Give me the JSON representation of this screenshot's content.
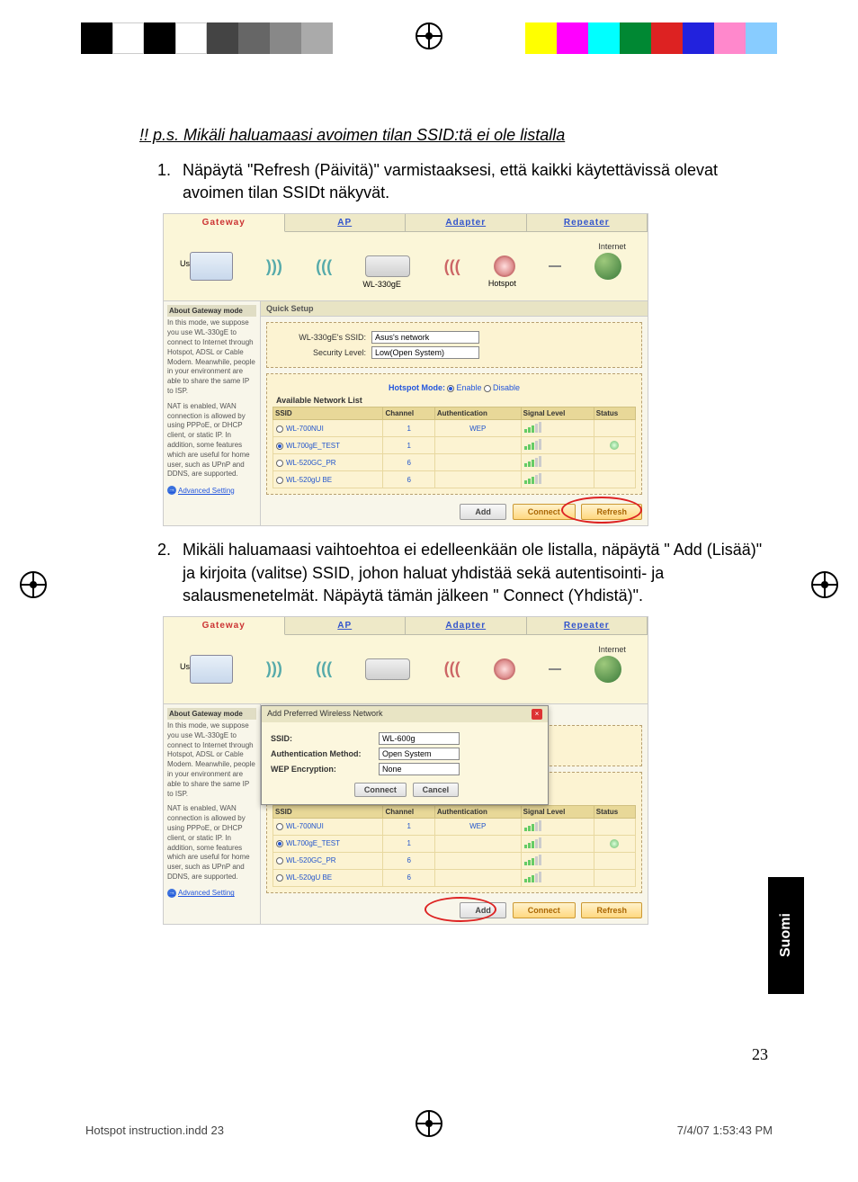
{
  "print_bar_colors": [
    "#000",
    "#fff"
  ],
  "ps_note": "!! p.s. Mikäli haluamaasi avoimen tilan SSID:tä ei ole listalla",
  "steps": [
    {
      "num": "1.",
      "text": "Näpäytä \"Refresh (Päivitä)\" varmistaaksesi, että kaikki käytettävissä olevat avoimen tilan SSIDt näkyvät."
    },
    {
      "num": "2.",
      "text": "Mikäli haluamaasi vaihtoehtoa ei edelleenkään ole listalla, näpäytä \" Add (Lisää)\" ja kirjoita (valitse) SSID, johon haluat yhdistää sekä autentisointi- ja salausmenetelmät. Näpäytä tämän jälkeen \" Connect (Yhdistä)\"."
    }
  ],
  "router": {
    "tabs": [
      "Gateway",
      "AP",
      "Adapter",
      "Repeater"
    ],
    "illust": {
      "user": "User",
      "device": "WL-330gE",
      "hotspot": "Hotspot",
      "internet": "Internet"
    },
    "sidebar": {
      "title": "About Gateway mode",
      "p1": "In this mode, we suppose you use WL-330gE to connect to Internet through Hotspot, ADSL or Cable Modem. Meanwhile, people in your environment are able to share the same IP to ISP.",
      "p2": "NAT is enabled, WAN connection is allowed by using PPPoE, or DHCP client, or static IP. In addition, some features which are useful for home user, such as UPnP and DDNS, are supported.",
      "adv": "Advanced Setting"
    },
    "quick_setup": "Quick Setup",
    "ssid_label": "WL-330gE's SSID:",
    "ssid_value": "Asus's network",
    "sec_label": "Security Level:",
    "sec_value": "Low(Open System)",
    "hotspot_mode": {
      "label": "Hotspot Mode:",
      "enable": "Enable",
      "disable": "Disable"
    },
    "avail_title": "Available Network List",
    "table": {
      "headers": [
        "SSID",
        "Channel",
        "Authentication",
        "Signal Level",
        "Status"
      ],
      "rows": [
        {
          "ssid": "WL-700NUI",
          "ch": "1",
          "auth": "WEP",
          "sel": false,
          "ok": false
        },
        {
          "ssid": "WL700gE_TEST",
          "ch": "1",
          "auth": "",
          "sel": true,
          "ok": true
        },
        {
          "ssid": "WL-520GC_PR",
          "ch": "6",
          "auth": "",
          "sel": false,
          "ok": false
        },
        {
          "ssid": "WL-520gU BE",
          "ch": "6",
          "auth": "",
          "sel": false,
          "ok": false
        }
      ]
    },
    "buttons": {
      "add": "Add",
      "connect": "Connect",
      "refresh": "Refresh"
    },
    "dialog": {
      "title": "Add Preferred Wireless Network",
      "ssid_label": "SSID:",
      "ssid_value": "WL-600g",
      "auth_label": "Authentication Method:",
      "auth_value": "Open System",
      "wep_label": "WEP Encryption:",
      "wep_value": "None",
      "connect": "Connect",
      "cancel": "Cancel"
    }
  },
  "side_tab": "Suomi",
  "page_num": "23",
  "footer": {
    "left": "Hotspot instruction.indd   23",
    "right": "7/4/07   1:53:43 PM"
  }
}
